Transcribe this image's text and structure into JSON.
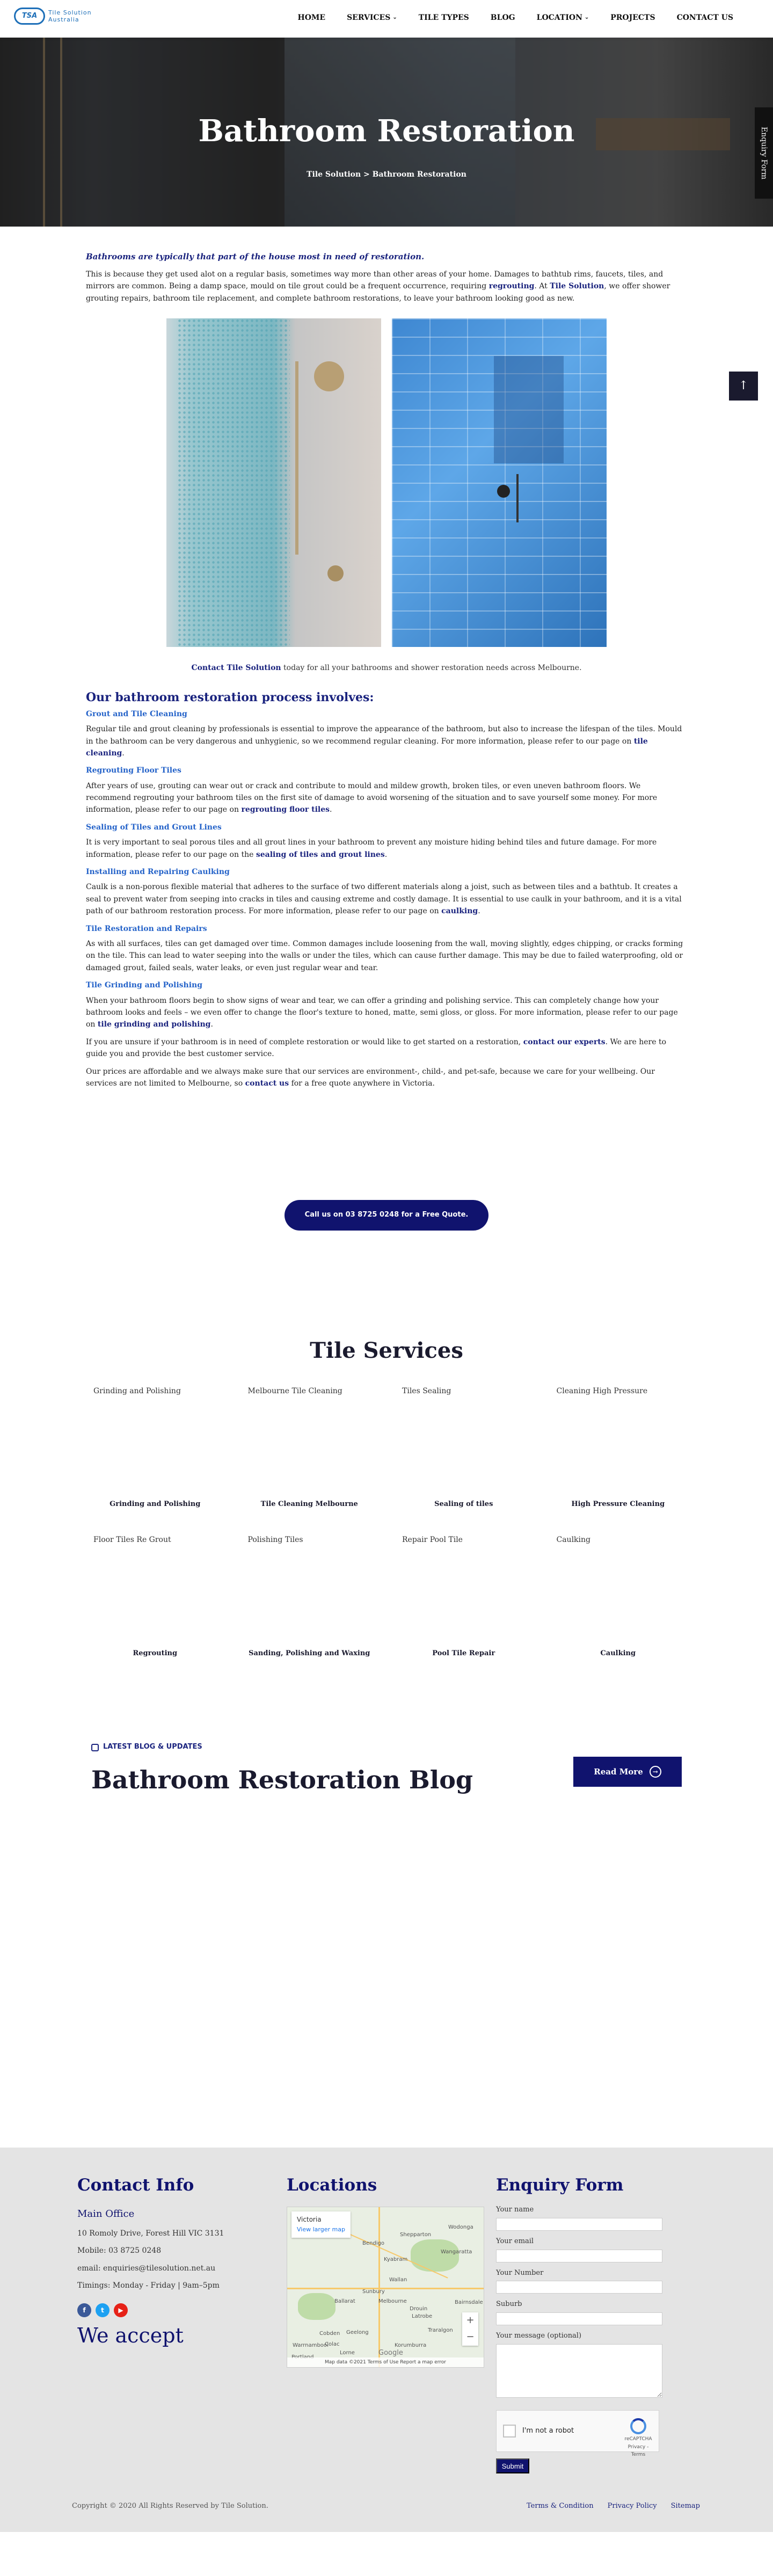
{
  "header": {
    "logo_mark": "TSA",
    "logo_title": "Tile Solution",
    "logo_sub": "Australia",
    "nav": [
      {
        "label": "HOME"
      },
      {
        "label": "SERVICES"
      },
      {
        "label": "TILE TYPES"
      },
      {
        "label": "BLOG"
      },
      {
        "label": "LOCATION"
      },
      {
        "label": "PROJECTS"
      },
      {
        "label": "CONTACT US"
      }
    ]
  },
  "hero": {
    "title": "Bathroom Restoration",
    "breadcrumb": "Tile Solution > Bathroom Restoration"
  },
  "side_tab": "Enquiry Form",
  "to_top_icon": "↑",
  "intro": {
    "lead": "Bathrooms are typically that part of the house most in need of restoration.",
    "p1a": "This is because they get used alot on a regular basis, sometimes way more than other areas of your home. Damages to bathtub rims, faucets, tiles, and mirrors are common. Being a damp space, mould on tile grout could be a frequent occurrence, requiring ",
    "p1_link1": "regrouting",
    "p1b": ". At ",
    "p1_link2": "Tile Solution",
    "p1c": ", we offer shower grouting repairs, bathroom tile replacement, and complete bathroom restorations, to leave your bathroom looking good as new."
  },
  "contact_line": {
    "link": "Contact Tile Solution",
    "text": " today for all your bathrooms and shower restoration needs across Melbourne."
  },
  "process": {
    "heading": "Our bathroom restoration process involves:",
    "grout_title": "Grout and Tile Cleaning",
    "grout_text": "Regular tile and grout cleaning by professionals is essential to improve the appearance of the bathroom, but also to increase the lifespan of the tiles. Mould in the bathroom can be very dangerous and unhygienic, so we recommend regular cleaning. For more information, please refer to our page on ",
    "grout_link": "tile cleaning",
    "regrout_title": "Regrouting Floor Tiles",
    "regrout_text": "After years of use, grouting can wear out or crack and contribute to mould and mildew growth, broken tiles, or even uneven bathroom floors. We recommend regrouting your bathroom tiles on the first site of damage to avoid worsening of the situation and to save yourself some money. For more information, please refer to our page on ",
    "regrout_link": "regrouting floor tiles",
    "seal_title": "Sealing of Tiles and Grout Lines",
    "seal_text": "It is very important to seal porous tiles and all grout lines in your bathroom to prevent any moisture hiding behind tiles and future damage. For more information, please refer to our page on the ",
    "seal_link": "sealing of tiles and grout lines",
    "caulk_title": "Installing and Repairing Caulking",
    "caulk_text": "Caulk is a non-porous flexible material that adheres to the surface of two different materials along a joist, such as between tiles and a bathtub. It creates a seal to prevent water from seeping into cracks in tiles and causing extreme and costly damage. It is essential to use caulk in your bathroom, and it is a vital path of our bathroom restoration process. For more information, please refer to our page on ",
    "caulk_link": "caulking",
    "repair_title": "Tile Restoration and Repairs",
    "repair_text": "As with all surfaces, tiles can get damaged over time. Common damages include loosening from the wall, moving slightly, edges chipping, or cracks forming on the tile. This can lead to water seeping into the walls or under the tiles, which can cause further damage. This may be due to failed waterproofing, old or damaged grout, failed seals, water leaks, or even just regular wear and tear.",
    "grind_title": "Tile Grinding and Polishing",
    "grind_text": "When your bathroom floors begin to show signs of wear and tear, we can offer a grinding and polishing service. This can completely change how your bathroom looks and feels – we even offer to change the floor's texture to honed, matte, semi gloss, or gloss. For more information, please refer to our page on ",
    "grind_link": "tile grinding and polishing",
    "unsure_a": "If you are unsure if your bathroom is in need of complete restoration or would like to get started on a restoration, ",
    "unsure_link": "contact our experts",
    "unsure_b": ". We are here to guide you and provide the best customer service.",
    "prices_a": "Our prices are affordable and we always make sure that our services are environment-, child-, and pet-safe, because we care for your wellbeing. Our services are not limited to Melbourne, so ",
    "prices_link": "contact us",
    "prices_b": " for a free quote anywhere in Victoria."
  },
  "cta": "Call us on 03 8725 0248 for a Free Quote.",
  "services": {
    "title": "Tile Services",
    "row1": [
      {
        "top": "Grinding and Polishing",
        "name": "Grinding and Polishing"
      },
      {
        "top": "Melbourne Tile Cleaning",
        "name": "Tile Cleaning Melbourne"
      },
      {
        "top": "Tiles Sealing",
        "name": "Sealing of tiles"
      },
      {
        "top": "Cleaning High Pressure",
        "name": "High Pressure Cleaning"
      }
    ],
    "row2": [
      {
        "top": "Floor Tiles Re Grout",
        "name": "Regrouting"
      },
      {
        "top": "Polishing Tiles",
        "name": "Sanding, Polishing and Waxing"
      },
      {
        "top": "Repair Pool Tile",
        "name": "Pool Tile Repair"
      },
      {
        "top": "Caulking",
        "name": "Caulking"
      }
    ]
  },
  "blog": {
    "label": "LATEST BLOG & UPDATES",
    "title": "Bathroom Restoration Blog",
    "read_more": "Read More",
    "read_more_icon": "→"
  },
  "footer": {
    "contact_title": "Contact Info",
    "office": "Main Office",
    "address": "10 Romoly Drive, Forest Hill VIC 3131",
    "mobile": "Mobile: 03 8725 0248",
    "email": "email: enquiries@tilesolution.net.au",
    "timings": "Timings: Monday - Friday | 9am–5pm",
    "socials": [
      {
        "icon": "f",
        "color": "#3b5998"
      },
      {
        "icon": "t",
        "color": "#1da1f2"
      },
      {
        "icon": "▶",
        "color": "#e62117"
      }
    ],
    "accept": "We accept",
    "locations_title": "Locations",
    "map_place": "Victoria",
    "map_link": "View larger map",
    "map_labels": [
      "Bendigo",
      "Shepparton",
      "Wodonga",
      "Wangaratta",
      "Warrnambool",
      "Geelong",
      "Traralgon",
      "Melbourne",
      "Ballarat",
      "Wallan",
      "Latrobe",
      "Korumburra",
      "Bairnsdale",
      "Drouin",
      "Cobden",
      "Lorne",
      "Portland",
      "Colac",
      "Kyabram",
      "Sunbury"
    ],
    "map_foot": "Map data ©2021   Terms of Use   Report a map error",
    "map_brand": "Google",
    "form_title": "Enquiry Form",
    "f_name": "Your name",
    "f_email": "Your email",
    "f_number": "Your Number",
    "f_suburb": "Suburb",
    "f_message": "Your message (optional)",
    "captcha": "I'm not a robot",
    "captcha_brand": "reCAPTCHA",
    "captcha_sub": "Privacy - Terms",
    "submit": "Submit",
    "copyright": "Copyright © 2020 All Rights Reserved by Tile Solution.",
    "links": [
      "Terms & Condition",
      "Privacy Policy",
      "Sitemap"
    ]
  }
}
